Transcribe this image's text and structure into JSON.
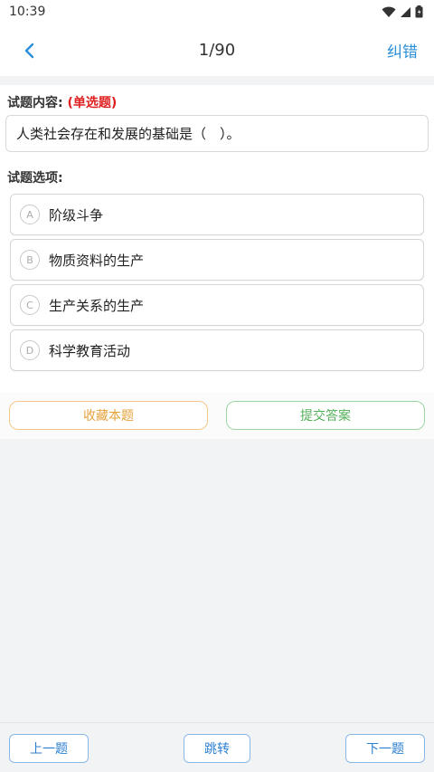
{
  "status_bar": {
    "time": "10:39"
  },
  "nav": {
    "counter": "1/90",
    "action_label": "纠错"
  },
  "question": {
    "label": "试题内容:",
    "type_tag": "(单选题)",
    "text": "人类社会存在和发展的基础是（　）。"
  },
  "options": {
    "label": "试题选项:",
    "items": [
      {
        "letter": "A",
        "text": "阶级斗争"
      },
      {
        "letter": "B",
        "text": "物质资料的生产"
      },
      {
        "letter": "C",
        "text": "生产关系的生产"
      },
      {
        "letter": "D",
        "text": "科学教育活动"
      }
    ]
  },
  "actions": {
    "favorite_label": "收藏本题",
    "submit_label": "提交答案"
  },
  "footer": {
    "prev_label": "上一题",
    "jump_label": "跳转",
    "next_label": "下一题"
  },
  "colors": {
    "accent": "#2b8fd8",
    "type_tag": "#e02020",
    "favorite": "#e6a23c",
    "submit": "#52b05a"
  }
}
